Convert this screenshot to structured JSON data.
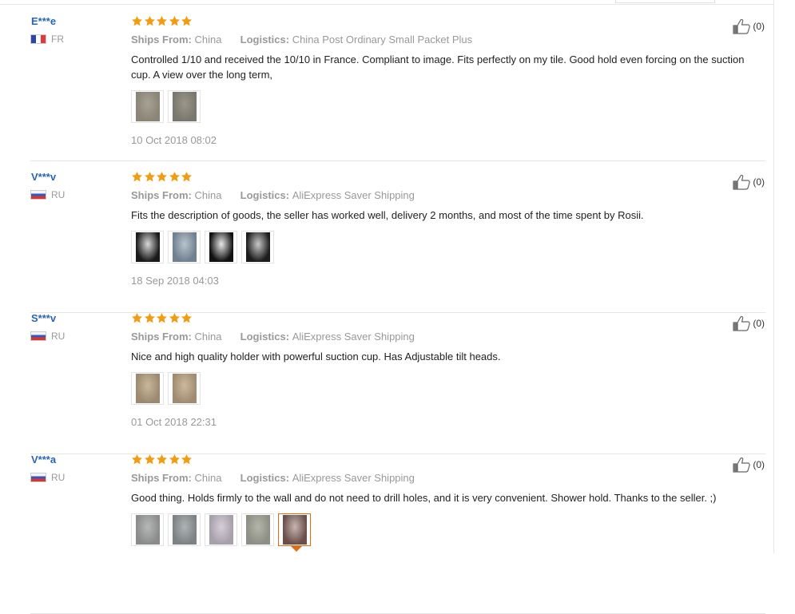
{
  "labels": {
    "ships_from": "Ships From:",
    "logistics": "Logistics:"
  },
  "colors": {
    "star": "#f39c12",
    "username": "#2a66b8",
    "active_photo_border": "#e26c10"
  },
  "reviews": [
    {
      "user": "E***e",
      "country": "FR",
      "flag": "fr",
      "stars": 5,
      "ships_from": "China",
      "logistics": "China Post Ordinary Small Packet Plus",
      "text": "Controlled 1/10 and received the 10/10 in France. Compliant to image. Fits perfectly on my tile. Good hold even forcing on the suction cup. A view over the long term,",
      "photo_count": 2,
      "date": "10 Oct 2018 08:02",
      "helpful": "(0)"
    },
    {
      "user": "V***v",
      "country": "RU",
      "flag": "ru",
      "stars": 5,
      "ships_from": "China",
      "logistics": "AliExpress Saver Shipping",
      "text": "Fits the description of goods, the seller has worked well, delivery 2 months, and most of the time spent by Rosii.",
      "photo_count": 4,
      "date": "18 Sep 2018 04:03",
      "helpful": "(0)"
    },
    {
      "user": "S***v",
      "country": "RU",
      "flag": "ru",
      "stars": 5,
      "ships_from": "China",
      "logistics": "AliExpress Saver Shipping",
      "text": "Nice and high quality holder with powerful suction cup. Has Adjustable tilt heads.",
      "photo_count": 2,
      "date": "01 Oct 2018 22:31",
      "helpful": "(0)"
    },
    {
      "user": "V***a",
      "country": "RU",
      "flag": "ru",
      "stars": 5,
      "ships_from": "China",
      "logistics": "AliExpress Saver Shipping",
      "text": "Good thing. Holds firmly to the wall and do not need to drill holes, and it is very convenient. Shower hold. Thanks to the seller. ;)",
      "photo_count": 5,
      "active_photo": 5,
      "date": "",
      "helpful": "(0)"
    }
  ]
}
